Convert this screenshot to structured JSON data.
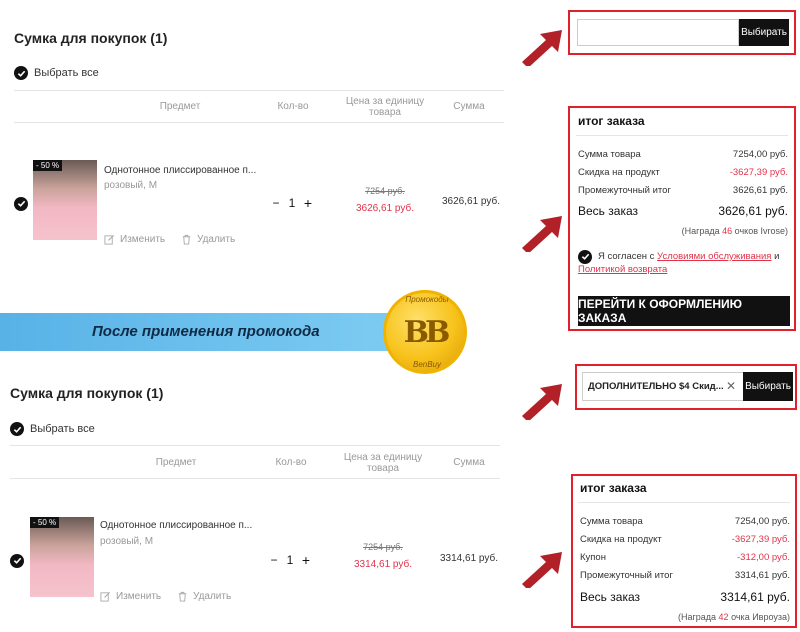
{
  "top": {
    "cart_title": "Сумка для покупок (1)",
    "select_all": "Выбрать все",
    "headers": [
      "Предмет",
      "Кол-во",
      "Цена за единицу товара",
      "Сумма"
    ],
    "item": {
      "badge": "- 50 %",
      "name": "Однотонное плиссированное п...",
      "variant": "розовый, M",
      "qty": "1",
      "old_price": "7254 руб.",
      "new_price": "3626,61 руб.",
      "sum": "3626,61 руб.",
      "edit": "Изменить",
      "delete": "Удалить"
    }
  },
  "banner": {
    "text": "После применения промокода"
  },
  "logo": {
    "letters": "BB",
    "ring_top": "Промокоды",
    "ring_bottom": "BenBuy"
  },
  "coupon1": {
    "value": "",
    "button": "Выбирать"
  },
  "summary1": {
    "title": "итог заказа",
    "lines": [
      {
        "label": "Сумма товара",
        "value": "7254,00 руб."
      },
      {
        "label": "Скидка на продукт",
        "value": "-3627,39 руб."
      },
      {
        "label": "Промежуточный итог",
        "value": "3626,61 руб."
      }
    ],
    "total_label": "Весь заказ",
    "total_value": "3626,61 руб.",
    "reward_prefix": "(Награда ",
    "reward_num": "46",
    "reward_suffix": " очков Ivrose)",
    "agree_prefix": "Я согласен с ",
    "agree_terms": "Условиями обслуживания",
    "agree_and": " и",
    "agree_policy": "Политикой возврата",
    "checkout": "ПЕРЕЙТИ К ОФОРМЛЕНИЮ ЗАКАЗА"
  },
  "bottom": {
    "cart_title": "Сумка для покупок (1)",
    "select_all": "Выбрать все",
    "headers": [
      "Предмет",
      "Кол-во",
      "Цена за единицу товара",
      "Сумма"
    ],
    "item": {
      "badge": "- 50 %",
      "name": "Однотонное плиссированное п...",
      "variant": "розовый, M",
      "qty": "1",
      "old_price": "7254 руб.",
      "new_price": "3314,61 руб.",
      "sum": "3314,61 руб.",
      "edit": "Изменить",
      "delete": "Удалить"
    }
  },
  "coupon2": {
    "value": "ДОПОЛНИТЕЛЬНО $4 Скид...",
    "button": "Выбирать"
  },
  "summary2": {
    "title": "итог заказа",
    "lines": [
      {
        "label": "Сумма товара",
        "value": "7254,00 руб."
      },
      {
        "label": "Скидка на продукт",
        "value": "-3627,39 руб."
      },
      {
        "label": "Купон",
        "value": "-312,00 руб."
      },
      {
        "label": "Промежуточный итог",
        "value": "3314,61 руб."
      }
    ],
    "total_label": "Весь заказ",
    "total_value": "3314,61 руб.",
    "reward_prefix": "(Награда ",
    "reward_num": "42",
    "reward_suffix": " очка Ивроуза)"
  },
  "colors": {
    "highlight": "#e0202b",
    "price_red": "#e0334a",
    "banner": "#58b2e6",
    "arrow": "#b22028"
  }
}
